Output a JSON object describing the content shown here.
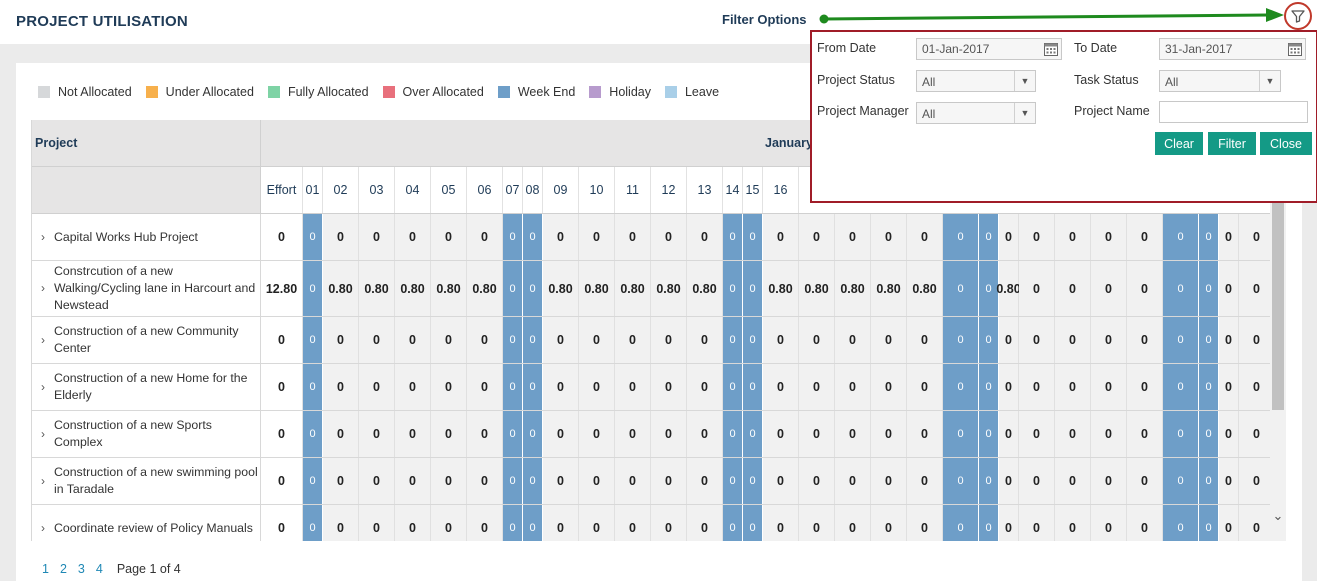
{
  "page_title": "PROJECT UTILISATION",
  "annotation": "Filter Options",
  "colors": {
    "accent_teal": "#149a86",
    "weekend_blue": "#6e9ec8",
    "panel_border": "#a01c28",
    "arrow_green": "#1e8a1e"
  },
  "legend": [
    {
      "label": "Not Allocated",
      "color": "#d6d8da"
    },
    {
      "label": "Under Allocated",
      "color": "#f7b04c"
    },
    {
      "label": "Fully Allocated",
      "color": "#7ed3a5"
    },
    {
      "label": "Over Allocated",
      "color": "#e8707c"
    },
    {
      "label": "Week End",
      "color": "#6e9ec8"
    },
    {
      "label": "Holiday",
      "color": "#b79bcd"
    },
    {
      "label": "Leave",
      "color": "#a9cfe8"
    }
  ],
  "table": {
    "project_header": "Project",
    "month_header": "January",
    "effort_header": "Effort",
    "days": [
      "01",
      "02",
      "03",
      "04",
      "05",
      "06",
      "07",
      "08",
      "09",
      "10",
      "11",
      "12",
      "13",
      "14",
      "15",
      "16"
    ],
    "rows": [
      {
        "name": "Capital Works Hub Project",
        "effort": "0",
        "cells": [
          "0",
          "0",
          "0",
          "0",
          "0",
          "0",
          "0",
          "0",
          "0",
          "0",
          "0",
          "0",
          "0",
          "0",
          "0",
          "0",
          "0",
          "0",
          "0",
          "0",
          "0",
          "0",
          "0",
          "0",
          "0",
          "0",
          "0",
          "0",
          "0",
          "0",
          "0"
        ]
      },
      {
        "name": "Constrcution of a new Walking/Cycling lane in Harcourt and Newstead",
        "effort": "12.80",
        "cells": [
          "0",
          "0.80",
          "0.80",
          "0.80",
          "0.80",
          "0.80",
          "0",
          "0",
          "0.80",
          "0.80",
          "0.80",
          "0.80",
          "0.80",
          "0",
          "0",
          "0.80",
          "0.80",
          "0.80",
          "0.80",
          "0.80",
          "0",
          "0",
          "0.80",
          "0",
          "0",
          "0",
          "0",
          "0",
          "0",
          "0",
          "0"
        ]
      },
      {
        "name": "Construction of a new Community Center",
        "effort": "0",
        "cells": [
          "0",
          "0",
          "0",
          "0",
          "0",
          "0",
          "0",
          "0",
          "0",
          "0",
          "0",
          "0",
          "0",
          "0",
          "0",
          "0",
          "0",
          "0",
          "0",
          "0",
          "0",
          "0",
          "0",
          "0",
          "0",
          "0",
          "0",
          "0",
          "0",
          "0",
          "0"
        ]
      },
      {
        "name": "Construction of a new Home for the Elderly",
        "effort": "0",
        "cells": [
          "0",
          "0",
          "0",
          "0",
          "0",
          "0",
          "0",
          "0",
          "0",
          "0",
          "0",
          "0",
          "0",
          "0",
          "0",
          "0",
          "0",
          "0",
          "0",
          "0",
          "0",
          "0",
          "0",
          "0",
          "0",
          "0",
          "0",
          "0",
          "0",
          "0",
          "0"
        ]
      },
      {
        "name": "Construction of a new Sports Complex",
        "effort": "0",
        "cells": [
          "0",
          "0",
          "0",
          "0",
          "0",
          "0",
          "0",
          "0",
          "0",
          "0",
          "0",
          "0",
          "0",
          "0",
          "0",
          "0",
          "0",
          "0",
          "0",
          "0",
          "0",
          "0",
          "0",
          "0",
          "0",
          "0",
          "0",
          "0",
          "0",
          "0",
          "0"
        ]
      },
      {
        "name": "Construction of a new swimming pool in Taradale",
        "effort": "0",
        "cells": [
          "0",
          "0",
          "0",
          "0",
          "0",
          "0",
          "0",
          "0",
          "0",
          "0",
          "0",
          "0",
          "0",
          "0",
          "0",
          "0",
          "0",
          "0",
          "0",
          "0",
          "0",
          "0",
          "0",
          "0",
          "0",
          "0",
          "0",
          "0",
          "0",
          "0",
          "0"
        ]
      },
      {
        "name": "Coordinate review of Policy Manuals",
        "effort": "0",
        "cells": [
          "0",
          "0",
          "0",
          "0",
          "0",
          "0",
          "0",
          "0",
          "0",
          "0",
          "0",
          "0",
          "0",
          "0",
          "0",
          "0",
          "0",
          "0",
          "0",
          "0",
          "0",
          "0",
          "0",
          "0",
          "0",
          "0",
          "0",
          "0",
          "0",
          "0",
          "0"
        ]
      }
    ]
  },
  "pagination": {
    "pages": [
      "1",
      "2",
      "3",
      "4"
    ],
    "info": "Page 1 of 4"
  },
  "filter": {
    "from_date_label": "From Date",
    "from_date_value": "01-Jan-2017",
    "to_date_label": "To Date",
    "to_date_value": "31-Jan-2017",
    "project_status_label": "Project Status",
    "project_status_value": "All",
    "task_status_label": "Task Status",
    "task_status_value": "All",
    "project_manager_label": "Project Manager",
    "project_manager_value": "All",
    "project_name_label": "Project Name",
    "project_name_value": "",
    "clear_label": "Clear",
    "filter_label": "Filter",
    "close_label": "Close"
  }
}
